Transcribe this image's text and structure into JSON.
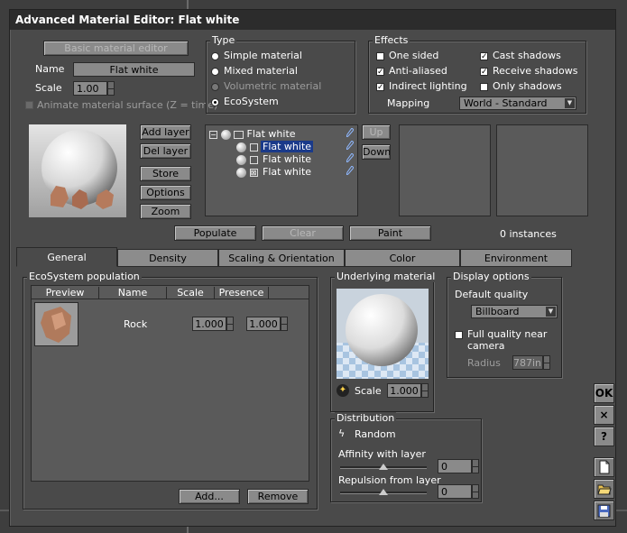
{
  "window": {
    "title": "Advanced Material Editor: Flat white"
  },
  "top": {
    "basic_editor_label": "Basic material editor",
    "name_label": "Name",
    "name_value": "Flat white",
    "scale_label": "Scale",
    "scale_value": "1.00",
    "animate_label": "Animate material surface (Z = time)"
  },
  "type": {
    "title": "Type",
    "options": [
      "Simple material",
      "Mixed material",
      "Volumetric material",
      "EcoSystem"
    ],
    "selected": "EcoSystem"
  },
  "effects": {
    "title": "Effects",
    "one_sided": "One sided",
    "anti_aliased": "Anti-aliased",
    "indirect_lighting": "Indirect lighting",
    "cast_shadows": "Cast shadows",
    "receive_shadows": "Receive shadows",
    "only_shadows": "Only shadows",
    "mapping_label": "Mapping",
    "mapping_value": "World - Standard"
  },
  "layer_buttons": {
    "add": "Add layer",
    "del": "Del layer",
    "store": "Store",
    "options": "Options",
    "zoom": "Zoom"
  },
  "tree": {
    "root": "Flat white",
    "children": [
      "Flat white",
      "Flat white",
      "Flat white"
    ],
    "up": "Up",
    "down": "Down"
  },
  "actions": {
    "populate": "Populate",
    "clear": "Clear",
    "paint": "Paint",
    "instances": "0 instances"
  },
  "tabs": [
    "General",
    "Density",
    "Scaling & Orientation",
    "Color",
    "Environment"
  ],
  "population": {
    "title": "EcoSystem population",
    "columns": [
      "Preview",
      "Name",
      "Scale",
      "Presence"
    ],
    "rows": [
      {
        "name": "Rock",
        "scale": "1.000",
        "presence": "1.000"
      }
    ],
    "add": "Add...",
    "remove": "Remove"
  },
  "underlying": {
    "title": "Underlying material",
    "scale_label": "Scale",
    "scale_value": "1.000"
  },
  "display": {
    "title": "Display options",
    "default_quality_label": "Default quality",
    "quality_value": "Billboard",
    "full_quality_label_1": "Full quality near",
    "full_quality_label_2": "camera",
    "radius_label": "Radius",
    "radius_value": "787in."
  },
  "distribution": {
    "title": "Distribution",
    "random_label": "Random",
    "affinity_label": "Affinity with layer",
    "affinity_value": "0",
    "repulsion_label": "Repulsion from layer",
    "repulsion_value": "0"
  },
  "side": {
    "ok": "OK",
    "close": "×",
    "help": "?"
  }
}
